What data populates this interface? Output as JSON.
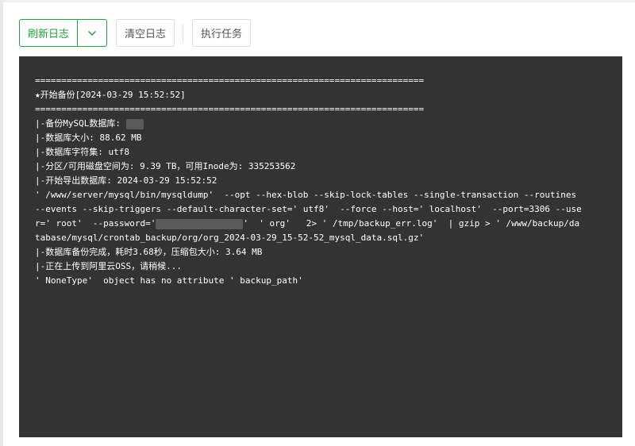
{
  "toolbar": {
    "refresh_label": "刷新日志",
    "clear_label": "清空日志",
    "run_label": "执行任务"
  },
  "colors": {
    "accent": "#20a53a",
    "log_background": "#333333",
    "log_text": "#ffffff"
  },
  "icons": {
    "dropdown": "chevron-down-icon"
  },
  "log": {
    "lines": [
      "==========================================================================",
      "★开始备份[2024-03-29 15:52:52]",
      "==========================================================================",
      "|-备份MySQL数据库: ",
      "|-数据库大小: 88.62 MB",
      "|-数据库字符集: utf8",
      "|-分区/可用磁盘空间为: 9.39 TB，可用Inode为: 335253562",
      "|-开始导出数据库: 2024-03-29 15:52:52",
      "' /www/server/mysql/bin/mysqldump'  --opt --hex-blob --skip-lock-tables --single-transaction --routines",
      "--events --skip-triggers --default-character-set=' utf8'  --force --host=' localhost'  --port=3306 --use",
      "r=' root'  --password='",
      "tabase/mysql/crontab_backup/org/org_2024-03-29_15-52-52_mysql_data.sql.gz'",
      "|-数据库备份完成，耗时3.68秒，压缩包大小: 3.64 MB",
      "|-正在上传到阿里云OSS，请稍候...",
      "' NoneType'  object has no attribute ' backup_path'"
    ],
    "password_tail": "'  ' org'   2> ' /tmp/backup_err.log'  | gzip > ' /www/backup/da"
  }
}
